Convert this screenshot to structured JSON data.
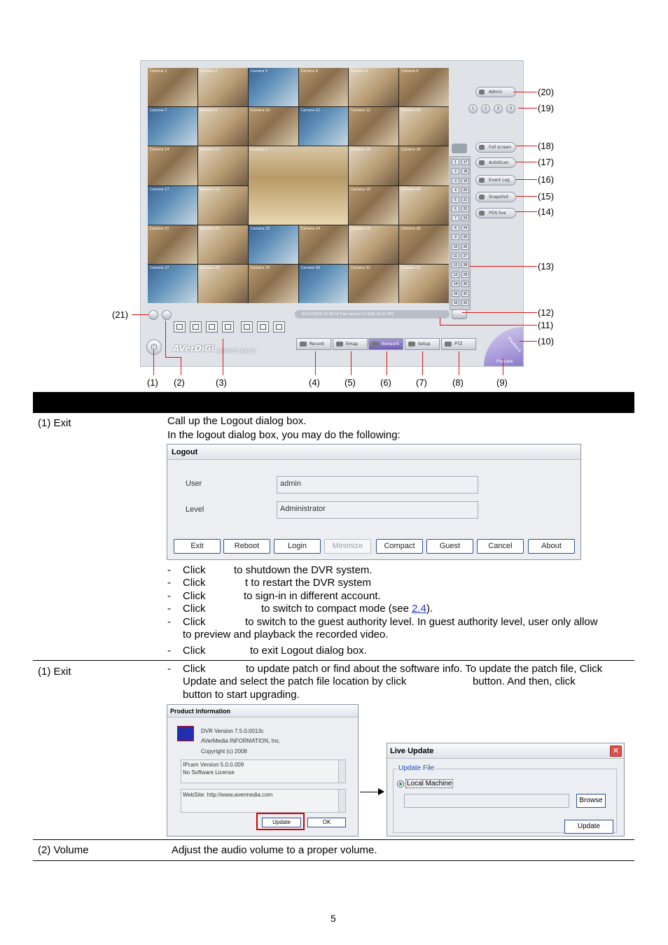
{
  "dvr_screenshot": {
    "cameras": [
      "Camera 1",
      "Camera 2",
      "Camera 3",
      "Camera 4",
      "Camera 5",
      "Camera 6",
      "Camera 7",
      "Camera 8",
      "Camera 10",
      "Camera 11",
      "Camera 12",
      "Camera 13",
      "Camera 14",
      "Camera 15",
      "Camera 1",
      "Camera 15",
      "Camera 16",
      "Camera 17",
      "Camera 18",
      "Camera 19",
      "Camera 20",
      "Camera 21",
      "Camera 22",
      "Camera 23",
      "Camera 24",
      "Camera 25",
      "Camera 26",
      "Camera 27",
      "Camera 28",
      "Camera 29",
      "Camera 30",
      "Camera 31",
      "Camera 32"
    ],
    "status_text": "02/10/2009 16:38:18  Free Space=17.9GB (8+2)  EPC",
    "brand": "AVerDiGi",
    "model": "XR8032 RACK",
    "side_buttons": [
      "Admin",
      "Full screen",
      "AutoScan",
      "Event Log",
      "Snapshot",
      "POS live"
    ],
    "speed_buttons": [
      "1",
      "2",
      "3",
      "4"
    ],
    "bottom_buttons": [
      "Record",
      "Emap",
      "Network",
      "Setup",
      "PTZ"
    ],
    "preview_label": "Preview",
    "playback_label": "Playback",
    "channel_numbers": [
      "1",
      "17",
      "2",
      "18",
      "3",
      "19",
      "4",
      "20",
      "5",
      "21",
      "6",
      "22",
      "7",
      "23",
      "8",
      "24",
      "9",
      "25",
      "10",
      "26",
      "11",
      "27",
      "12",
      "28",
      "13",
      "29",
      "14",
      "30",
      "15",
      "31",
      "16",
      "32"
    ],
    "callouts": {
      "c20": "(20)",
      "c19": "(19)",
      "c18": "(18)",
      "c17": "(17)",
      "c16": "(16)",
      "c15": "(15)",
      "c14": "(14)",
      "c13": "(13)",
      "c12": "(12)",
      "c11": "(11)",
      "c10": "(10)",
      "c21": "(21)",
      "c1": "(1)",
      "c2": "(2)",
      "c3": "(3)",
      "c4": "(4)",
      "c5": "(5)",
      "c6": "(6)",
      "c7": "(7)",
      "c8": "(8)",
      "c9": "(9)"
    }
  },
  "row1": {
    "label": "(1) Exit",
    "line1": "Call up the Logout dialog box.",
    "line2": "In the logout dialog box, you may do the following:",
    "bullets": {
      "b1a": "Click",
      "b1b": "to shutdown the DVR system.",
      "b2a": "Click",
      "b2b": "t to restart the DVR system",
      "b3a": "Click",
      "b3b": "to sign-in in different account.",
      "b4a": "Click",
      "b4b": "to switch to compact mode (see ",
      "b4link": "2.4",
      "b4c": ").",
      "b5a": "Click",
      "b5b": "to switch to the guest authority level. In guest authority level, user only allow",
      "b5c": "to preview and playback the recorded video.",
      "b6a": "Click",
      "b6b": "to exit Logout dialog box."
    }
  },
  "logout_dialog": {
    "title": "Logout",
    "user_label": "User",
    "user_value": "admin",
    "level_label": "Level",
    "level_value": "Administrator",
    "buttons": [
      "Exit",
      "Reboot",
      "Login",
      "Minimize",
      "Compact",
      "Guest",
      "Cancel",
      "About"
    ]
  },
  "row2": {
    "label": "(1) Exit",
    "l1a": "Click",
    "l1b": "to update patch or find about the software info. To update the patch file, Click",
    "l2a": "Update and select the patch file location by click",
    "l2b": "button. And then, click",
    "l3": "button to start upgrading."
  },
  "product_info": {
    "title": "Product Information",
    "version": "DVR Version 7.5.0.0013c",
    "company": "AVerMedia INFORMATION, Inc.",
    "copyright": "Copyright (c) 2008",
    "ipcam": "IPcam Version 5.0.0.009",
    "license": "No Software License",
    "website": "WebSite: http://www.avermedia.com",
    "update_btn": "Update",
    "ok_btn": "OK"
  },
  "live_update": {
    "title": "Live Update",
    "close": "✕",
    "group": "Update File",
    "radio": "Local Machine",
    "browse_btn": "Browse",
    "update_btn": "Update"
  },
  "row3": {
    "label": "(2) Volume",
    "text": "Adjust the audio volume to a proper volume."
  },
  "page_number": "5"
}
